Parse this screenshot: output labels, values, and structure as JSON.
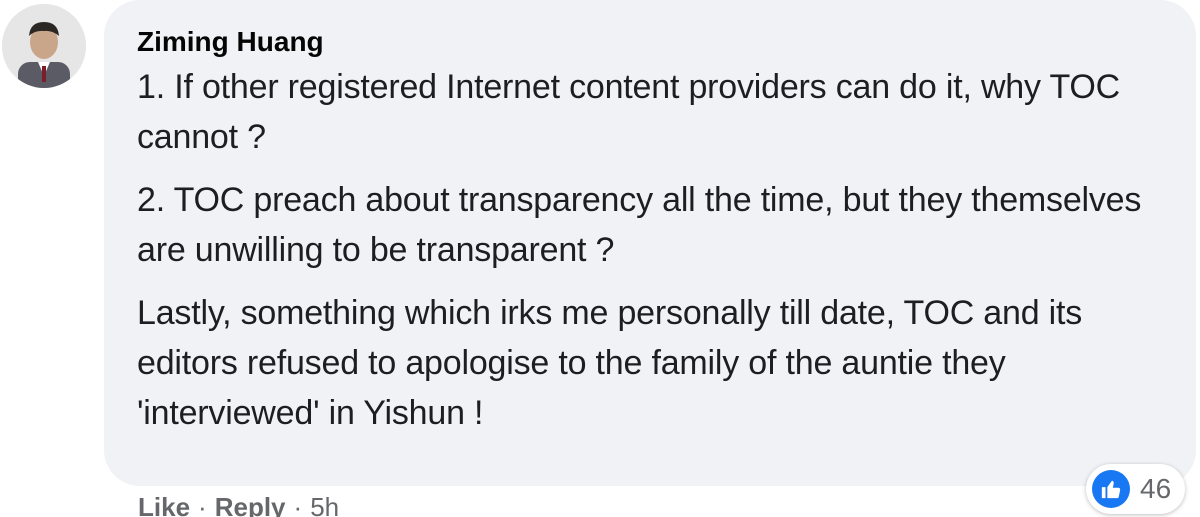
{
  "comment": {
    "author": "Ziming Huang",
    "paragraphs": [
      "1. If other registered Internet content providers can do it, why TOC cannot ?",
      "2. TOC preach about transparency all the time, but they themselves are unwilling to be transparent ?",
      "Lastly, something which irks me personally till date, TOC and its editors refused to apologise to the family of the auntie they 'interviewed' in Yishun !"
    ],
    "reaction_icon": "thumbs-up-icon",
    "reaction_count": "46",
    "actions": {
      "like": "Like",
      "reply": "Reply",
      "separator": "·",
      "timestamp": "5h"
    }
  },
  "colors": {
    "bubble": "#f0f2f5",
    "like_blue": "#1877f2",
    "meta_gray": "#65676b"
  }
}
